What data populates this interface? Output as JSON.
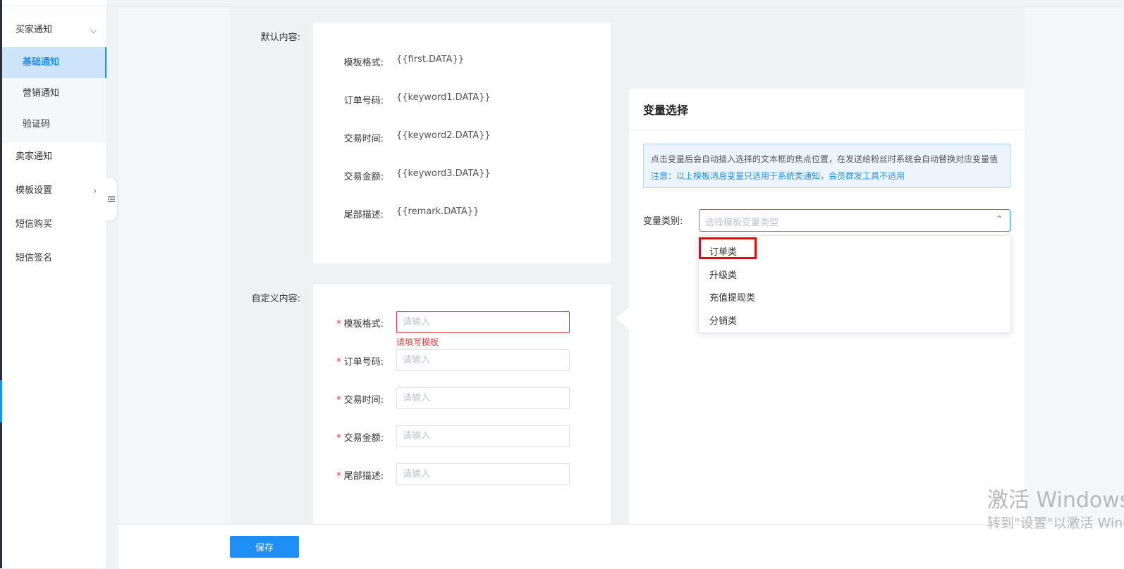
{
  "sidebar": {
    "buyer_notice": "买家通知",
    "sub_items": [
      "基础通知",
      "营销通知",
      "验证码"
    ],
    "seller_notice": "卖家通知",
    "template_settings": "模板设置",
    "sms_purchase": "短信购买",
    "sms_signature": "短信签名"
  },
  "default_section": {
    "label": "默认内容:",
    "rows": [
      {
        "label": "模板格式:",
        "value": "{{first.DATA}}"
      },
      {
        "label": "订单号码:",
        "value": "{{keyword1.DATA}}"
      },
      {
        "label": "交易时间:",
        "value": "{{keyword2.DATA}}"
      },
      {
        "label": "交易金额:",
        "value": "{{keyword3.DATA}}"
      },
      {
        "label": "尾部描述:",
        "value": "{{remark.DATA}}"
      }
    ]
  },
  "custom_section": {
    "label": "自定义内容:",
    "required_mark": "*",
    "placeholder": "请输入",
    "error_text": "请填写模板",
    "rows": [
      {
        "label": "模板格式:"
      },
      {
        "label": "订单号码:"
      },
      {
        "label": "交易时间:"
      },
      {
        "label": "交易金额:"
      },
      {
        "label": "尾部描述:"
      }
    ]
  },
  "variable_panel": {
    "title": "变量选择",
    "notice_line1": "点击变量后会自动插入选择的文本框的焦点位置，在发送给粉丝时系统会自动替换对应变量值",
    "notice_line2": "注意：以上模板消息变量只适用于系统类通知，会员群发工具不适用",
    "type_label": "变量类别:",
    "select_placeholder": "选择模板变量类型",
    "options": [
      "订单类",
      "升级类",
      "充值提现类",
      "分销类"
    ]
  },
  "footer": {
    "save_label": "保存"
  },
  "watermark": {
    "line1": "激活 Windows",
    "line2": "转到\"设置\"以激活 Windows。"
  },
  "colors": {
    "accent": "#1f8ff7",
    "error": "#e4393c",
    "highlight_box": "#e4080f"
  }
}
